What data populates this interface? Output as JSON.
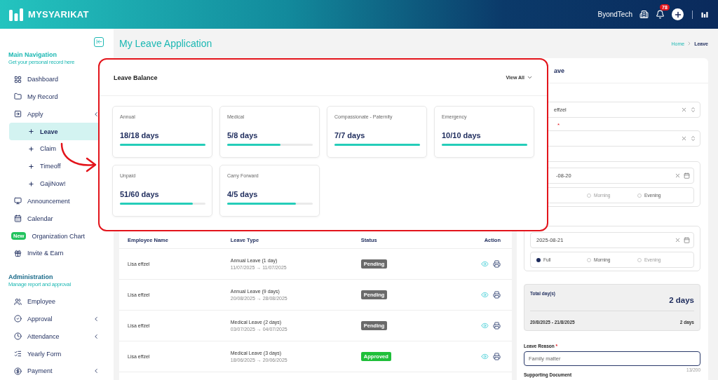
{
  "header": {
    "brand": "MYSYARIKAT",
    "company": "ByondTech",
    "notification_count": "78"
  },
  "sidebar": {
    "sections": [
      {
        "title": "Main Navigation",
        "subtitle": "Get your personal record here",
        "items": [
          {
            "label": "Dashboard",
            "selected": false
          },
          {
            "label": "My Record",
            "selected": false
          },
          {
            "label": "Apply",
            "selected": false,
            "has_submenu": true,
            "children": [
              {
                "label": "Leave",
                "selected": true
              },
              {
                "label": "Claim",
                "selected": false
              },
              {
                "label": "Timeoff",
                "selected": false
              },
              {
                "label": "GajiNow!",
                "selected": false
              }
            ]
          },
          {
            "label": "Announcement",
            "selected": false
          },
          {
            "label": "Calendar",
            "selected": false
          },
          {
            "label": "Organization Chart",
            "selected": false,
            "badge": "New"
          },
          {
            "label": "Invite & Earn",
            "selected": false
          }
        ]
      },
      {
        "title": "Administration",
        "subtitle": "Manage report and approval",
        "items": [
          {
            "label": "Employee",
            "selected": false
          },
          {
            "label": "Approval",
            "selected": false,
            "has_submenu": true
          },
          {
            "label": "Attendance",
            "selected": false,
            "has_submenu": true
          },
          {
            "label": "Yearly Form",
            "selected": false
          },
          {
            "label": "Payment",
            "selected": false,
            "has_submenu": true
          }
        ]
      }
    ]
  },
  "page": {
    "title": "My Leave Application",
    "breadcrumb": [
      {
        "label": "Home",
        "selected": false
      },
      {
        "label": "Leave",
        "selected": true
      }
    ]
  },
  "leave_balance": {
    "title": "Leave Balance",
    "view_all": "View All",
    "cards": [
      {
        "label": "Annual",
        "value": "18/18 days",
        "level": 1
      },
      {
        "label": "Medical",
        "value": "5/8 days",
        "level": 0.625
      },
      {
        "label": "Compassionate - Paternity",
        "value": "7/7 days",
        "level": 1
      },
      {
        "label": "Emergency",
        "value": "10/10 days",
        "level": 1
      },
      {
        "label": "Unpaid",
        "value": "51/60 days",
        "level": 0.85
      },
      {
        "label": "Carry Forward",
        "value": "4/5 days",
        "level": 0.8
      }
    ]
  },
  "table": {
    "columns": [
      "Employee Name",
      "Leave Type",
      "Status",
      "Action"
    ],
    "rows": [
      {
        "employee": "Lisa effzel",
        "leave_type": "Annual Leave (1 day)",
        "dates": "11/07/2025 → 11/07/2025",
        "status": {
          "label": "Pending",
          "kind": "pending"
        }
      },
      {
        "employee": "Lisa effzel",
        "leave_type": "Annual Leave (9 days)",
        "dates": "20/08/2025 → 28/08/2025",
        "status": {
          "label": "Pending",
          "kind": "pending"
        }
      },
      {
        "employee": "Lisa effzel",
        "leave_type": "Medical Leave (2 days)",
        "dates": "03/07/2025 → 04/07/2025",
        "status": {
          "label": "Pending",
          "kind": "pending"
        }
      },
      {
        "employee": "Lisa effzel",
        "leave_type": "Medical Leave (3 days)",
        "dates": "18/06/2025 → 20/06/2025",
        "status": {
          "label": "Approved",
          "kind": "approved"
        }
      }
    ]
  },
  "leave_form": {
    "heading": "ave",
    "employee": {
      "value": "effzel"
    },
    "leave_type": {
      "required_mark": "*"
    },
    "start": {
      "date": "-08-20",
      "options": [
        {
          "label": "Morning",
          "selected": false,
          "disabled": true
        },
        {
          "label": "Evening",
          "selected": false,
          "disabled": false
        }
      ]
    },
    "end": {
      "date": "2025-08-21",
      "options": [
        {
          "label": "Full",
          "selected": true,
          "disabled": false
        },
        {
          "label": "Morning",
          "selected": false,
          "disabled": false
        },
        {
          "label": "Evening",
          "selected": false,
          "disabled": true
        }
      ]
    },
    "total": {
      "label": "Total day(s)",
      "value": "2 days",
      "range": "20/8/2025 - 21/8/2025",
      "range_days": "2 days"
    },
    "reason": {
      "label": "Leave Reason",
      "required_mark": "*",
      "value": "Family matter",
      "counter": "13/200"
    },
    "supporting_label": "Supporting Document"
  }
}
